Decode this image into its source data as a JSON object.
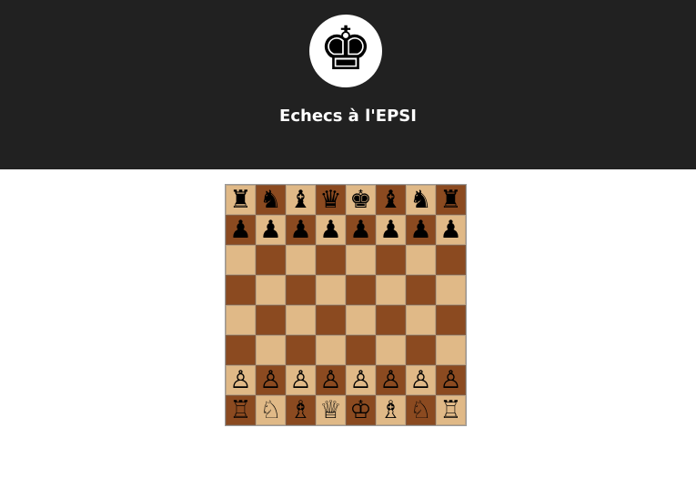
{
  "header": {
    "logo_icon": "king-icon",
    "logo_glyph": "♚",
    "title": "Echecs à l'EPSI"
  },
  "colors": {
    "header_bg": "#212121",
    "light_square": "#e0b987",
    "dark_square": "#8b4a20"
  },
  "board": {
    "ranks": [
      [
        "♜",
        "♞",
        "♝",
        "♛",
        "♚",
        "♝",
        "♞",
        "♜"
      ],
      [
        "♟",
        "♟",
        "♟",
        "♟",
        "♟",
        "♟",
        "♟",
        "♟"
      ],
      [
        "",
        "",
        "",
        "",
        "",
        "",
        "",
        ""
      ],
      [
        "",
        "",
        "",
        "",
        "",
        "",
        "",
        ""
      ],
      [
        "",
        "",
        "",
        "",
        "",
        "",
        "",
        ""
      ],
      [
        "",
        "",
        "",
        "",
        "",
        "",
        "",
        ""
      ],
      [
        "♙",
        "♙",
        "♙",
        "♙",
        "♙",
        "♙",
        "♙",
        "♙"
      ],
      [
        "♖",
        "♘",
        "♗",
        "♕",
        "♔",
        "♗",
        "♘",
        "♖"
      ]
    ],
    "names": [
      [
        "black-rook",
        "black-knight",
        "black-bishop",
        "black-queen",
        "black-king",
        "black-bishop",
        "black-knight",
        "black-rook"
      ],
      [
        "black-pawn",
        "black-pawn",
        "black-pawn",
        "black-pawn",
        "black-pawn",
        "black-pawn",
        "black-pawn",
        "black-pawn"
      ],
      [
        "",
        "",
        "",
        "",
        "",
        "",
        "",
        ""
      ],
      [
        "",
        "",
        "",
        "",
        "",
        "",
        "",
        ""
      ],
      [
        "",
        "",
        "",
        "",
        "",
        "",
        "",
        ""
      ],
      [
        "",
        "",
        "",
        "",
        "",
        "",
        "",
        ""
      ],
      [
        "white-pawn",
        "white-pawn",
        "white-pawn",
        "white-pawn",
        "white-pawn",
        "white-pawn",
        "white-pawn",
        "white-pawn"
      ],
      [
        "white-rook",
        "white-knight",
        "white-bishop",
        "white-queen",
        "white-king",
        "white-bishop",
        "white-knight",
        "white-rook"
      ]
    ]
  }
}
